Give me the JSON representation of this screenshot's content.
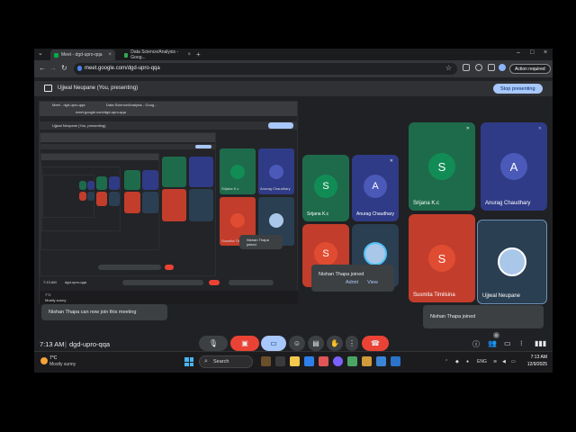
{
  "browser": {
    "tabs": [
      {
        "title": "Meet - dgd-upro-qqa",
        "active": true
      },
      {
        "title": "Data Science/Analysis - Goog...",
        "active": false
      }
    ],
    "url": "meet.google.com/dgd-upro-qqa",
    "action_label": "Action required"
  },
  "banner": {
    "presenter": "Ujjwal Neupane (You, presenting)",
    "stop_label": "Stop presenting"
  },
  "tiles": [
    {
      "name": "Srijana K.c",
      "initial": "S",
      "color": "green"
    },
    {
      "name": "Anurag Chaudhary",
      "initial": "A",
      "color": "blue"
    },
    {
      "name": "Susmita Timilsina",
      "initial": "S",
      "color": "red"
    },
    {
      "name": "Ujjwal Neupane",
      "initial": "",
      "color": "photo"
    }
  ],
  "toasts": {
    "join": "Nishan Thapa joined",
    "can_join": "Nishan Thapa can now join this meeting",
    "admit_label": "Admit",
    "view_label": "View"
  },
  "meeting": {
    "time": "7:13 AM",
    "separator": "|",
    "code": "dgd-upro-qqa",
    "participant_count": "6"
  },
  "share_preview": {
    "tab_title": "Meet - dgd-upro-qqa",
    "tab2_title": "Data Science/Analysis - Goog...",
    "url": "meet.google.com/dgd-upro-qqa",
    "presenter": "Ujjwal Neupane (You, presenting)",
    "stop_label": "Stop presenting",
    "tiles": [
      "Srijana K.c",
      "Anurag Chaudhary",
      "Susmita Timilsina",
      "Ujjwal Neupane"
    ],
    "time": "7:13 AM",
    "code": "dgd-upro-qqa",
    "toast_join": "Nishan Thapa joined",
    "admit_label": "Admit",
    "view_label": "View",
    "weather_t": "7°C",
    "weather_d": "Mostly sunny"
  },
  "taskbar": {
    "weather_temp": "7°C",
    "weather_desc": "Mostly sunny",
    "search_label": "Search",
    "lang": "ENG",
    "time": "7:13 AM",
    "date": "12/9/2025"
  },
  "colors": {
    "accent": "#a8c7fa",
    "end_call": "#ea4335",
    "tile_green": "#1e6b4c",
    "tile_blue": "#2f3b86",
    "tile_red": "#c23d2b"
  }
}
